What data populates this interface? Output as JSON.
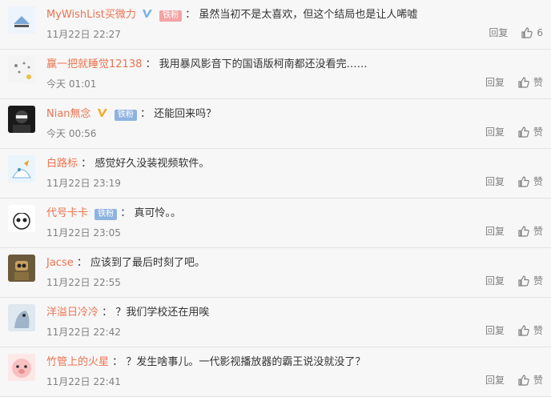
{
  "comments": [
    {
      "user": "MyWishList买微力",
      "verified": true,
      "fan_badge": "铁粉",
      "fan_color": "red",
      "text": "虽然当初不是太喜欢，但这个结局也是让人唏嘘",
      "time": "11月22日 22:27",
      "reply": "回复",
      "likes": "6"
    },
    {
      "user": "赢一把就睡觉12138",
      "verified": false,
      "fan_badge": "",
      "text": "我用暴风影音下的国语版柯南都还没看完……",
      "time": "今天 01:01",
      "reply": "回复",
      "likes": "赞"
    },
    {
      "user": "Nian無念",
      "verified": true,
      "fan_badge": "铁粉",
      "fan_color": "blue",
      "text": "还能回来吗？",
      "time": "今天 00:56",
      "reply": "回复",
      "likes": "赞"
    },
    {
      "user": "白路标",
      "verified": false,
      "fan_badge": "",
      "text": "感觉好久没装视频软件。",
      "time": "11月22日 23:19",
      "reply": "回复",
      "likes": "赞"
    },
    {
      "user": "代号卡卡",
      "verified": false,
      "fan_badge": "铁粉",
      "fan_color": "blue",
      "text": "真可怜。。",
      "time": "11月22日 23:05",
      "reply": "回复",
      "likes": "赞"
    },
    {
      "user": "Jacse",
      "verified": false,
      "fan_badge": "",
      "text": "应该到了最后时刻了吧。",
      "time": "11月22日 22:55",
      "reply": "回复",
      "likes": "赞"
    },
    {
      "user": "洋溢日冷冷",
      "verified": false,
      "fan_badge": "",
      "text": "？我们学校还在用唉",
      "time": "11月22日 22:42",
      "reply": "回复",
      "likes": "赞"
    },
    {
      "user": "竹管上的火星",
      "verified": false,
      "fan_badge": "",
      "text": "？发生啥事儿。一代影视播放器的霸王说没就没了？",
      "time": "11月22日 22:41",
      "reply": "回复",
      "likes": "赞"
    }
  ],
  "colors": {
    "username": "#eb7350",
    "meta": "#808080",
    "text": "#333333",
    "verified": "#f8a728"
  }
}
